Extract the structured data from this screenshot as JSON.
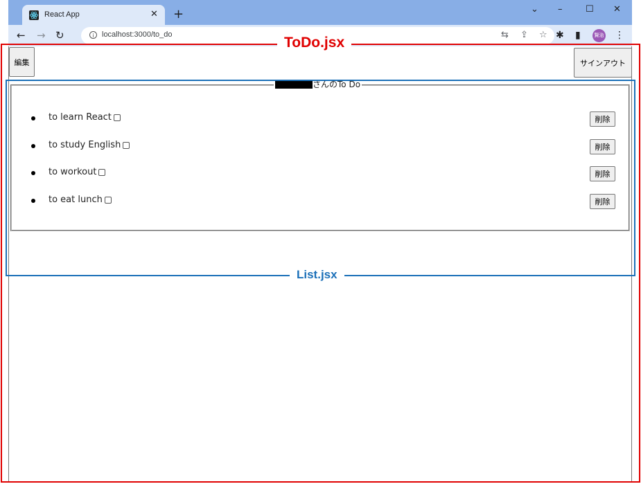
{
  "browser": {
    "tab_title": "React App",
    "tab_close": "✕",
    "new_tab": "+",
    "url": "localhost:3000/to_do",
    "profile_initials": "賢治",
    "window_controls": {
      "chevron": "⌄",
      "minimize": "–",
      "maximize": "☐",
      "close": "✕"
    },
    "nav": {
      "back": "←",
      "forward": "→",
      "reload": "↻"
    },
    "icons": {
      "info": "i",
      "translate": "⇆",
      "share": "⇪",
      "bookmark": "☆",
      "extensions": "✱",
      "side_panel": "▮",
      "menu": "⋮"
    }
  },
  "app": {
    "edit_button": "編集",
    "signout_button": "サインアウト",
    "legend_suffix": "さんのTo Do",
    "todos": [
      {
        "text": "to learn React",
        "delete_label": "削除"
      },
      {
        "text": "to study English",
        "delete_label": "削除"
      },
      {
        "text": "to workout",
        "delete_label": "削除"
      },
      {
        "text": "to eat lunch",
        "delete_label": "削除"
      }
    ]
  },
  "annotations": {
    "outer_label": "ToDo.jsx",
    "inner_label": "List.jsx",
    "outer_color": "#e00000",
    "inner_color": "#1a6fb8"
  }
}
